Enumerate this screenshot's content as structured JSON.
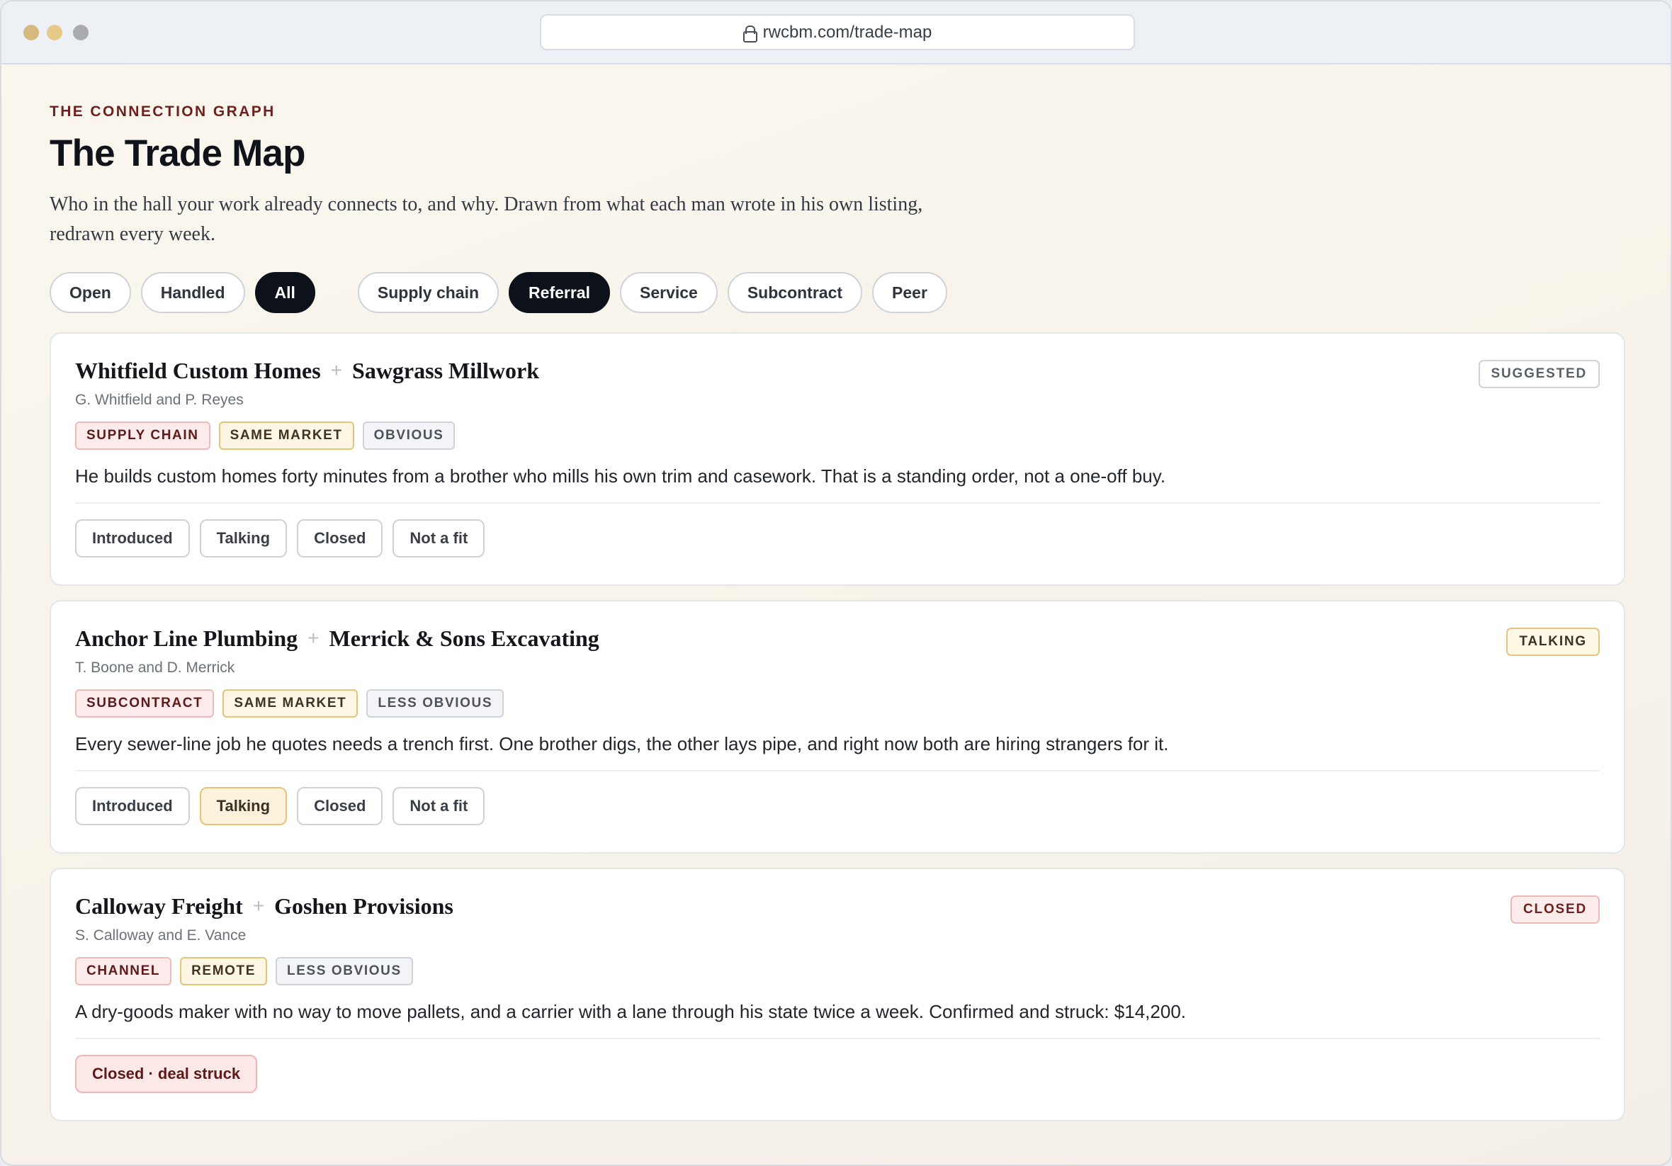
{
  "browser": {
    "url": "rwcbm.com/trade-map"
  },
  "header": {
    "eyebrow": "THE CONNECTION GRAPH",
    "title": "The Trade Map",
    "subtitle": "Who in the hall your work already connects to, and why. Drawn from what each man wrote in his own listing, redrawn every week."
  },
  "filters": {
    "status": [
      {
        "label": "Open",
        "active": false
      },
      {
        "label": "Handled",
        "active": false
      },
      {
        "label": "All",
        "active": true
      }
    ],
    "type": [
      {
        "label": "Supply chain",
        "active": false
      },
      {
        "label": "Referral",
        "active": true
      },
      {
        "label": "Service",
        "active": false
      },
      {
        "label": "Subcontract",
        "active": false
      },
      {
        "label": "Peer",
        "active": false
      }
    ]
  },
  "cards": [
    {
      "a": "Whitfield Custom Homes",
      "plus": "+",
      "b": "Sawgrass Millwork",
      "people": "G. Whitfield and P. Reyes",
      "status": "SUGGESTED",
      "tags": [
        "SUPPLY CHAIN",
        "SAME MARKET",
        "OBVIOUS"
      ],
      "reason": "He builds custom homes forty minutes from a brother who mills his own trim and casework. That is a standing order, not a one-off buy.",
      "actions": [
        "Introduced",
        "Talking",
        "Closed",
        "Not a fit"
      ]
    },
    {
      "a": "Anchor Line Plumbing",
      "plus": "+",
      "b": "Merrick & Sons Excavating",
      "people": "T. Boone and D. Merrick",
      "status": "TALKING",
      "tags": [
        "SUBCONTRACT",
        "SAME MARKET",
        "LESS OBVIOUS"
      ],
      "reason": "Every sewer-line job he quotes needs a trench first. One brother digs, the other lays pipe, and right now both are hiring strangers for it.",
      "actions": [
        "Introduced",
        "Talking",
        "Closed",
        "Not a fit"
      ]
    },
    {
      "a": "Calloway Freight",
      "plus": "+",
      "b": "Goshen Provisions",
      "people": "S. Calloway and E. Vance",
      "status": "CLOSED",
      "tags": [
        "CHANNEL",
        "REMOTE",
        "LESS OBVIOUS"
      ],
      "reason": "A dry-goods maker with no way to move pallets, and a carrier with a lane through his state twice a week. Confirmed and struck: $14,200.",
      "actions": [
        "Closed · deal struck"
      ]
    }
  ]
}
